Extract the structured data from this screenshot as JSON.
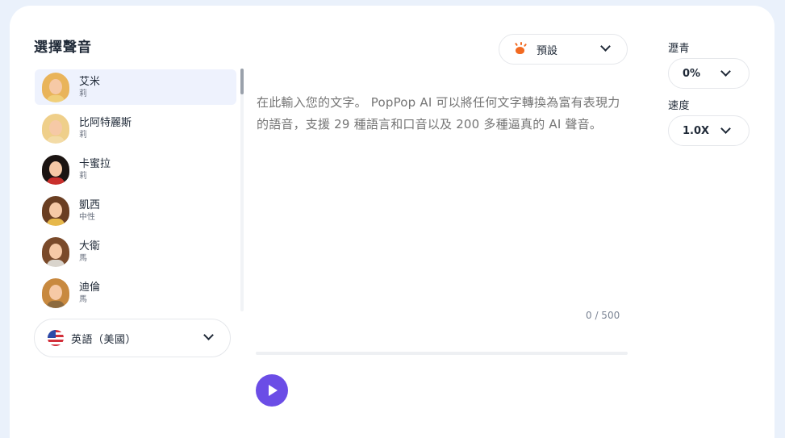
{
  "voice_panel": {
    "title": "選擇聲音",
    "voices": [
      {
        "name": "艾米",
        "tag": "莉",
        "selected": true,
        "hair": "#e9b45a",
        "shirt": "#f0cf7a"
      },
      {
        "name": "比阿特麗斯",
        "tag": "莉",
        "selected": false,
        "hair": "#efcf8a",
        "shirt": "#f3dba6"
      },
      {
        "name": "卡蜜拉",
        "tag": "莉",
        "selected": false,
        "hair": "#1b1412",
        "shirt": "#c9302c"
      },
      {
        "name": "凱西",
        "tag": "中性",
        "selected": false,
        "hair": "#6a3e22",
        "shirt": "#e6b84b"
      },
      {
        "name": "大衛",
        "tag": "馬",
        "selected": false,
        "hair": "#7a4a2a",
        "shirt": "#d9d4cc"
      },
      {
        "name": "迪倫",
        "tag": "馬",
        "selected": false,
        "hair": "#c8893f",
        "shirt": "#8c6a3e"
      }
    ],
    "language": {
      "label": "英語（美國）",
      "flag_icon": "us-flag-icon"
    }
  },
  "preset": {
    "label": "預設",
    "icon": "preset-sparkle-icon",
    "icon_color": "#f26a21"
  },
  "editor": {
    "placeholder": "在此輸入您的文字。 PopPop AI 可以將任何文字轉換為富有表現力的語音，支援 29 種語言和口音以及 200 多種逼真的 AI 聲音。",
    "counter": "0 / 500"
  },
  "player": {
    "progress_percent": 0,
    "accent": "#6b4de6"
  },
  "settings": {
    "pitch_label": "瀝青",
    "pitch_value": "0%",
    "speed_label": "速度",
    "speed_value": "1.0X"
  }
}
